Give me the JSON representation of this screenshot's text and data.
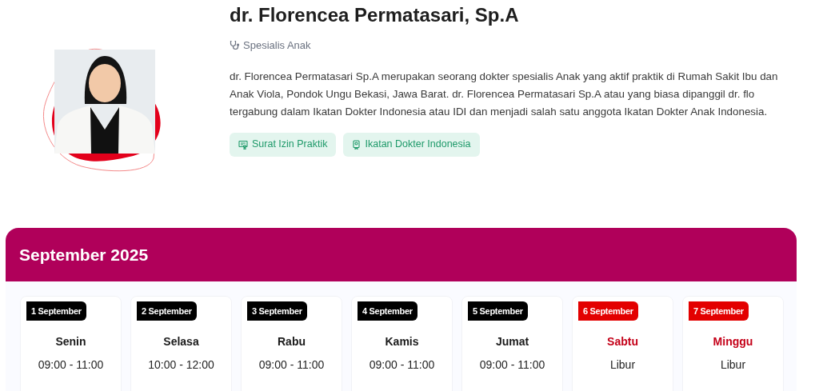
{
  "doctor": {
    "name": "dr. Florencea Permatasari, Sp.A",
    "specialty": "Spesialis Anak",
    "bio": "dr. Florencea Permatasari Sp.A merupakan seorang dokter spesialis Anak yang aktif praktik di Rumah Sakit Ibu dan Anak Viola, Pondok Ungu Bekasi, Jawa Barat. dr. Florencea Permatasari Sp.A atau yang biasa dipanggil dr. flo tergabung dalam Ikatan Dokter Indonesia atau IDI dan menjadi salah satu anggota Ikatan Dokter Anak Indonesia.",
    "badges": [
      {
        "kind": "license",
        "label": "Surat Izin Praktik"
      },
      {
        "kind": "membership",
        "label": "Ikatan Dokter Indonesia"
      }
    ]
  },
  "schedule": {
    "title": "September 2025",
    "days": [
      {
        "date": "1 September",
        "day": "Senin",
        "hours": "09:00 - 11:00",
        "holiday": false
      },
      {
        "date": "2 September",
        "day": "Selasa",
        "hours": "10:00 - 12:00",
        "holiday": false
      },
      {
        "date": "3 September",
        "day": "Rabu",
        "hours": "09:00 - 11:00",
        "holiday": false
      },
      {
        "date": "4 September",
        "day": "Kamis",
        "hours": "09:00 - 11:00",
        "holiday": false
      },
      {
        "date": "5 September",
        "day": "Jumat",
        "hours": "09:00 - 11:00",
        "holiday": false
      },
      {
        "date": "6 September",
        "day": "Sabtu",
        "hours": "Libur",
        "holiday": true
      },
      {
        "date": "7 September",
        "day": "Minggu",
        "hours": "Libur",
        "holiday": true
      }
    ]
  }
}
